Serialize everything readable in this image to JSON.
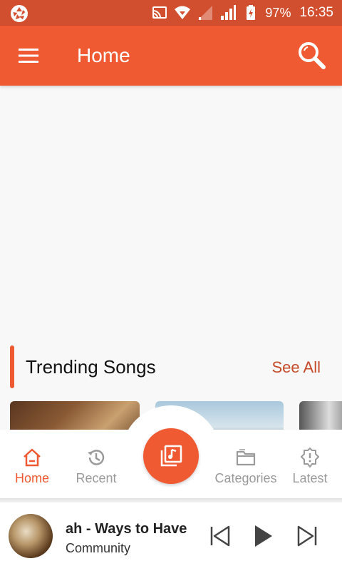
{
  "status_bar": {
    "battery": "97%",
    "time": "16:35"
  },
  "app_bar": {
    "title": "Home",
    "menu_icon": "hamburger-menu-icon",
    "search_icon": "search-icon"
  },
  "section": {
    "title": "Trending Songs",
    "see_all_label": "See All"
  },
  "bottom_nav": {
    "items": [
      {
        "label": "Home",
        "icon": "home-icon",
        "active": true
      },
      {
        "label": "Recent",
        "icon": "history-icon",
        "active": false
      },
      {
        "label": "Categories",
        "icon": "folder-icon",
        "active": false
      },
      {
        "label": "Latest",
        "icon": "badge-alert-icon",
        "active": false
      }
    ],
    "center_icon": "music-library-icon"
  },
  "player": {
    "track_title": "ah - Ways to Have",
    "artist": "Community"
  },
  "colors": {
    "status_bar": "#d14e2e",
    "accent": "#f05a33",
    "see_all": "#c44a29"
  }
}
